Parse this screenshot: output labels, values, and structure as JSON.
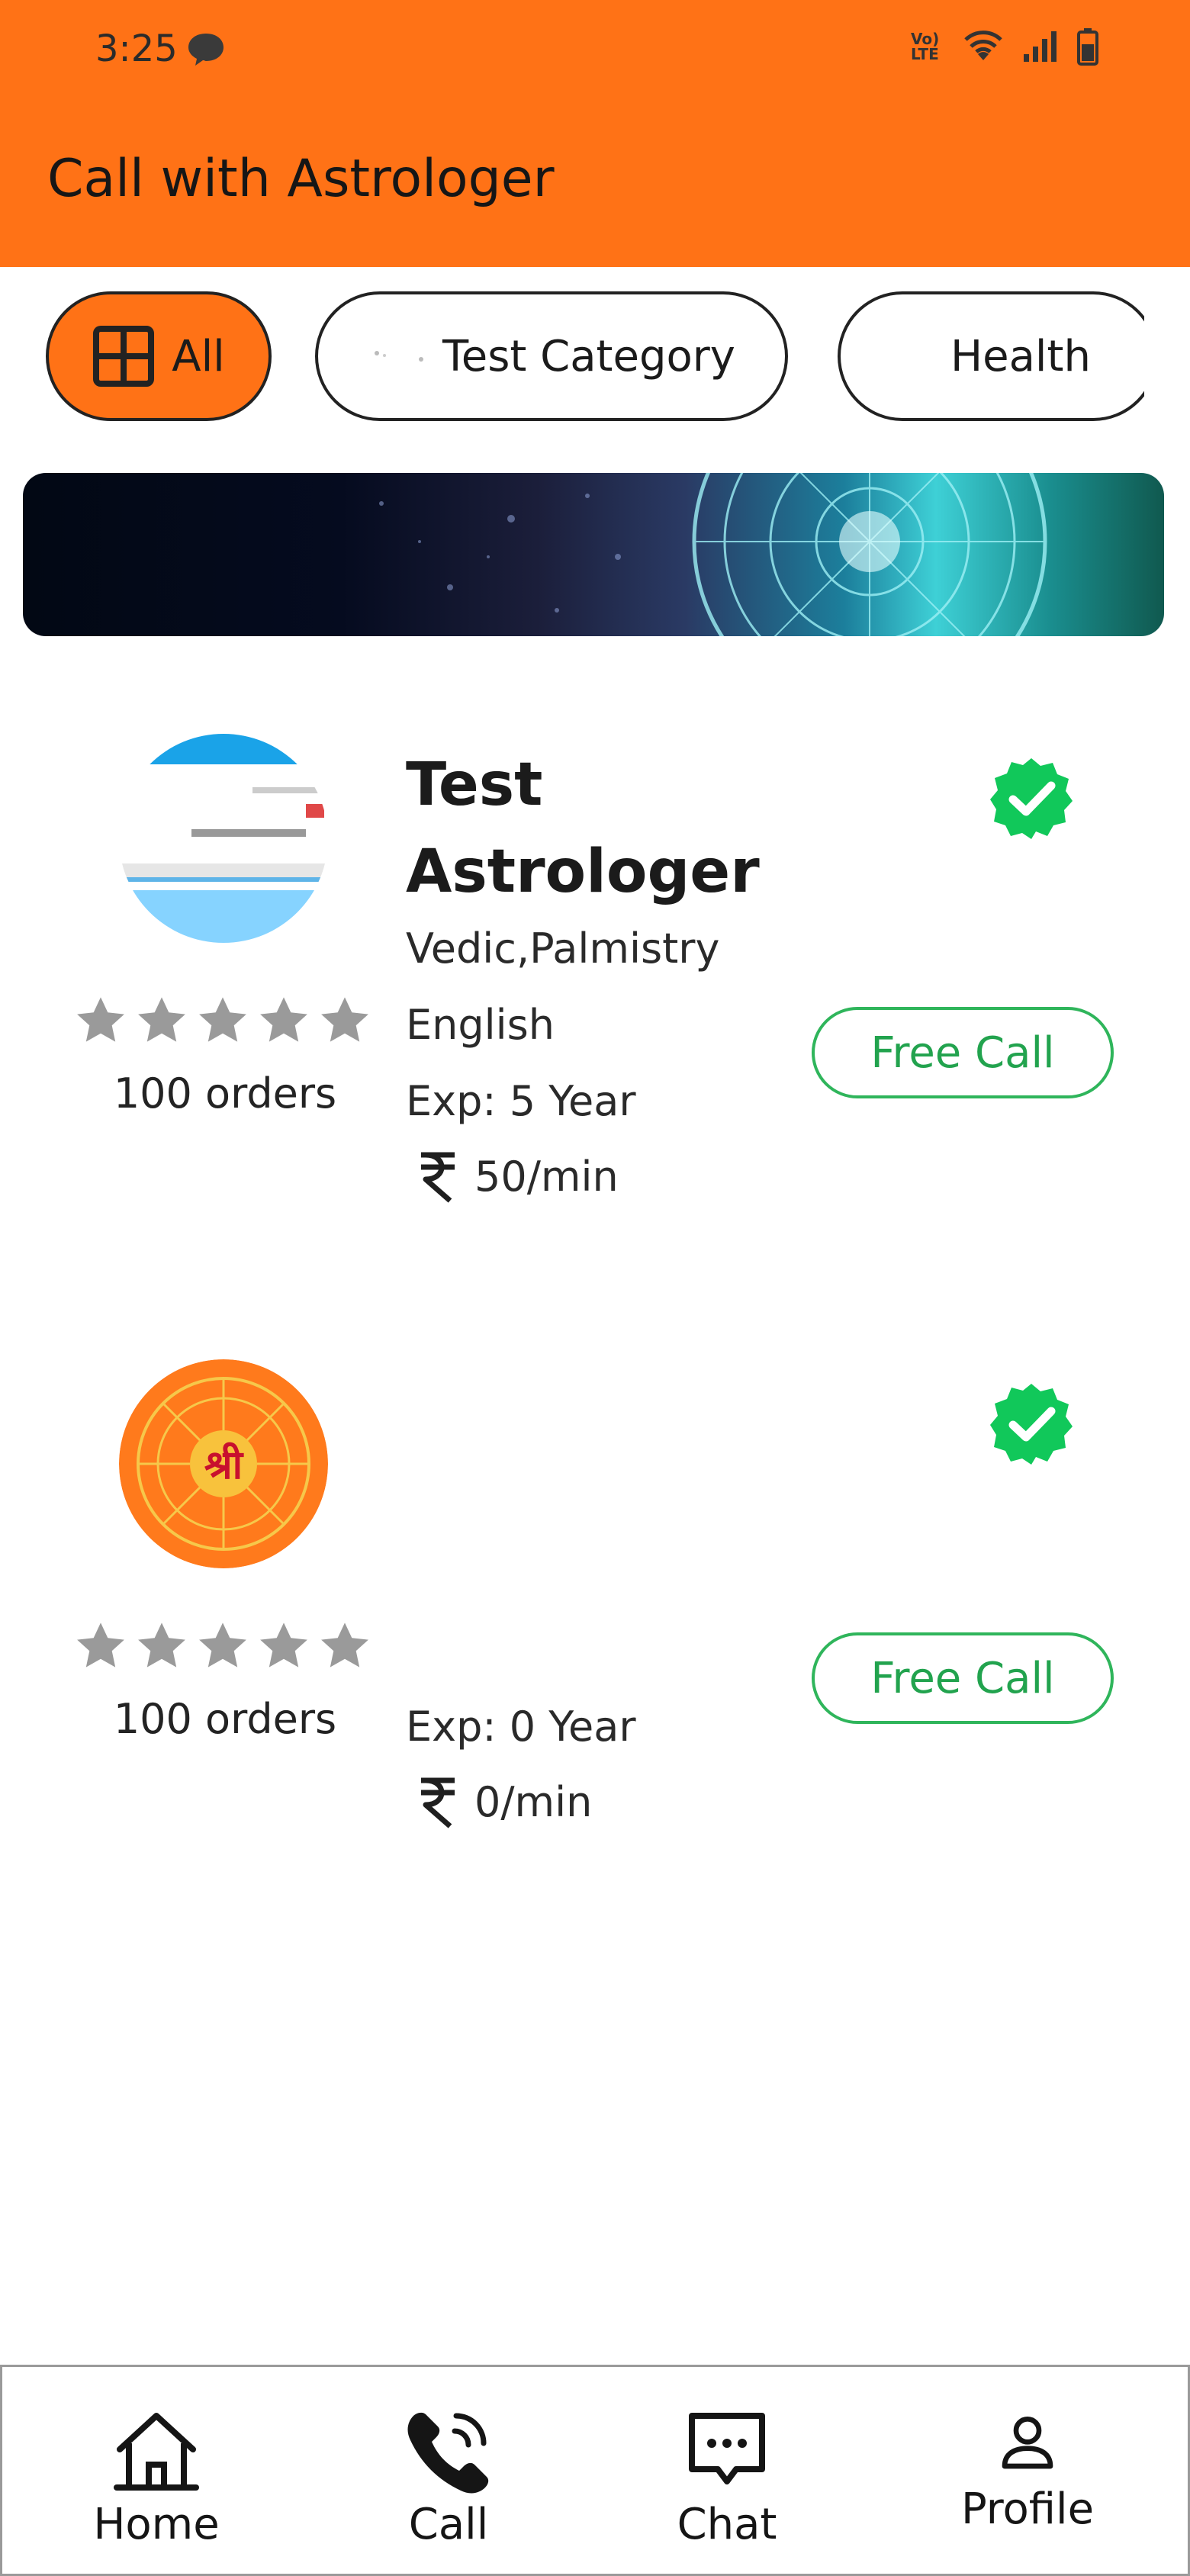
{
  "status_bar": {
    "time": "3:25",
    "network": "Vo) LTE"
  },
  "app_bar": {
    "title": "Call with Astrologer"
  },
  "categories": [
    {
      "label": "All",
      "selected": true,
      "icon": "grid-icon"
    },
    {
      "label": "Test Category",
      "selected": false
    },
    {
      "label": "Health",
      "selected": false
    }
  ],
  "astrologers": [
    {
      "name": "Test Astrologer",
      "skills": "Vedic,Palmistry",
      "language": "English",
      "experience": "Exp: 5 Year",
      "price": "50/min",
      "orders": "100 orders",
      "rating": 0,
      "verified": true,
      "call_button": "Free Call"
    },
    {
      "name": "",
      "skills": "",
      "language": "",
      "experience": "Exp: 0 Year",
      "price": "0/min",
      "orders": "100 orders",
      "rating": 0,
      "verified": true,
      "call_button": "Free Call",
      "avatar_text": "श्री"
    }
  ],
  "bottom_nav": [
    {
      "label": "Home",
      "icon": "home-icon"
    },
    {
      "label": "Call",
      "icon": "phone-icon"
    },
    {
      "label": "Chat",
      "icon": "chat-icon"
    },
    {
      "label": "Profile",
      "icon": "profile-icon"
    }
  ],
  "colors": {
    "primary": "#ff7216",
    "verified_green": "#11c85a",
    "free_call_green": "#22a34e",
    "star_gray": "#9a9a9a"
  }
}
